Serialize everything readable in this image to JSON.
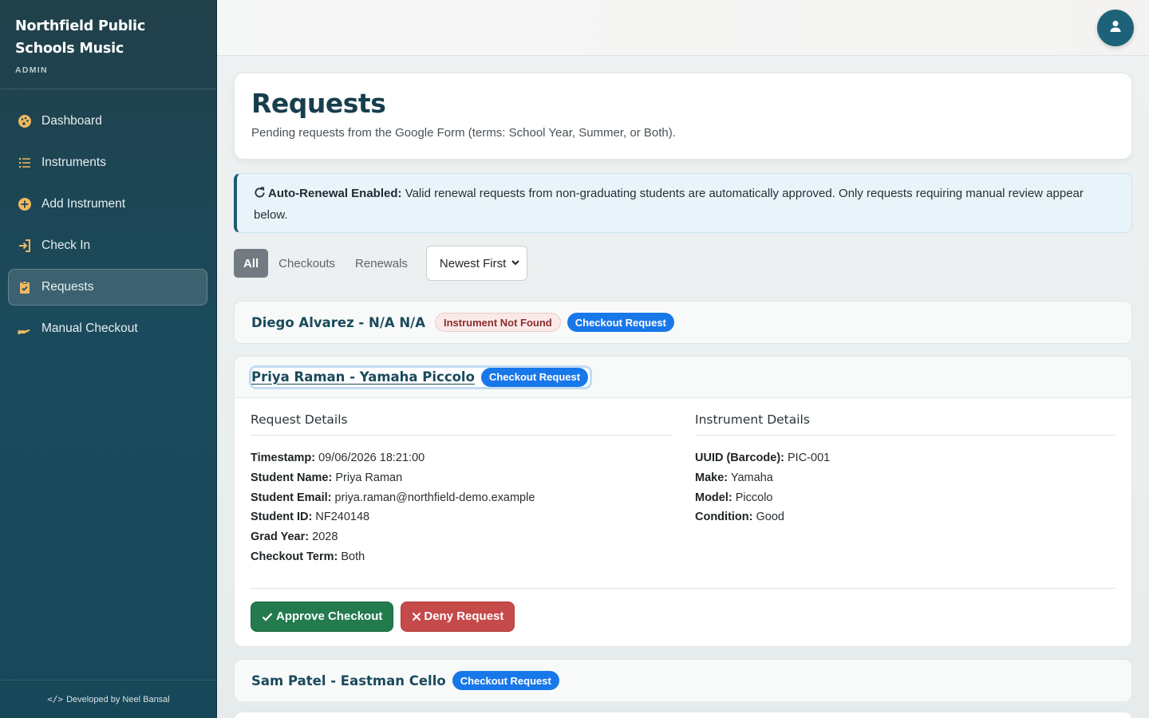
{
  "sidebar": {
    "brand_line1": "Northfield Public",
    "brand_line2": "Schools Music",
    "role": "ADMIN",
    "items": [
      {
        "label": "Dashboard",
        "icon": "palette-icon"
      },
      {
        "label": "Instruments",
        "icon": "list-icon"
      },
      {
        "label": "Add Instrument",
        "icon": "plus-circle-icon"
      },
      {
        "label": "Check In",
        "icon": "sign-in-icon"
      },
      {
        "label": "Requests",
        "icon": "clipboard-icon",
        "active": true
      },
      {
        "label": "Manual Checkout",
        "icon": "hand-icon"
      }
    ],
    "footer": "Developed by Neel Bansal"
  },
  "header": {
    "avatar_icon": "user-icon"
  },
  "page": {
    "title": "Requests",
    "description": "Pending requests from the Google Form (terms: School Year, Summer, or Both)."
  },
  "alert": {
    "title": "Auto-Renewal Enabled:",
    "text": "Valid renewal requests from non-graduating students are automatically approved. Only requests requiring manual review appear below."
  },
  "filters": {
    "tabs": [
      "All",
      "Checkouts",
      "Renewals"
    ],
    "active_tab": "All",
    "sort_value": "Newest First"
  },
  "requests": [
    {
      "name": "Diego Alvarez - N/A N/A",
      "badges": [
        "Instrument Not Found",
        "Checkout Request"
      ],
      "expanded": false
    },
    {
      "name": "Priya Raman - Yamaha Piccolo",
      "badges": [
        "Checkout Request"
      ],
      "expanded": true,
      "request_details_title": "Request Details",
      "instrument_details_title": "Instrument Details",
      "request_fields": [
        {
          "label": "Timestamp:",
          "value": "09/06/2026 18:21:00"
        },
        {
          "label": "Student Name:",
          "value": "Priya Raman"
        },
        {
          "label": "Student Email:",
          "value": "priya.raman@northfield-demo.example"
        },
        {
          "label": "Student ID:",
          "value": "NF240148"
        },
        {
          "label": "Grad Year:",
          "value": "2028"
        },
        {
          "label": "Checkout Term:",
          "value": "Both"
        }
      ],
      "instrument_fields": [
        {
          "label": "UUID (Barcode):",
          "value": "PIC-001"
        },
        {
          "label": "Make:",
          "value": "Yamaha"
        },
        {
          "label": "Model:",
          "value": "Piccolo"
        },
        {
          "label": "Condition:",
          "value": "Good"
        }
      ],
      "approve_label": "Approve Checkout",
      "deny_label": "Deny Request"
    },
    {
      "name": "Sam Patel - Eastman Cello",
      "badges": [
        "Checkout Request"
      ],
      "expanded": false
    }
  ],
  "colors": {
    "sidebar_bg": "#1b4a5c",
    "accent_blue": "#1877e9",
    "approve_green": "#237a4d",
    "deny_red": "#c54a4a",
    "title_teal": "#173e4d"
  }
}
